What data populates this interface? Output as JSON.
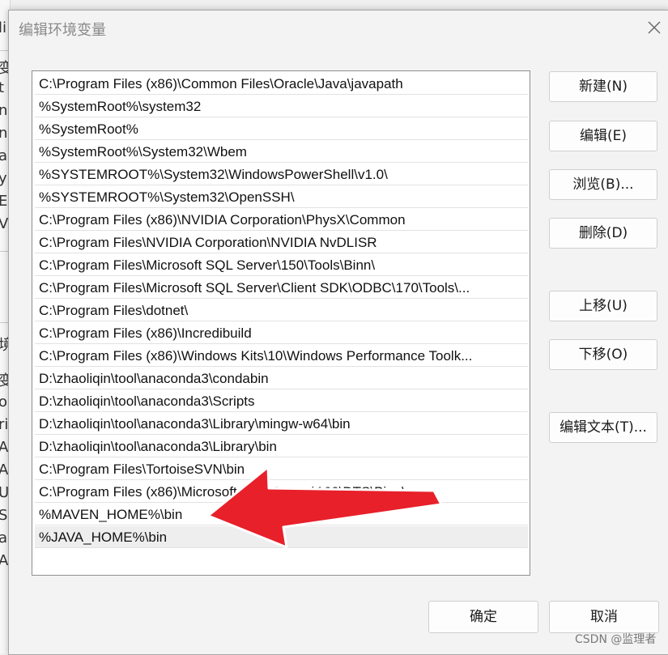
{
  "dialog": {
    "title": "编辑环境变量"
  },
  "paths": [
    "C:\\Program Files (x86)\\Common Files\\Oracle\\Java\\javapath",
    "%SystemRoot%\\system32",
    "%SystemRoot%",
    "%SystemRoot%\\System32\\Wbem",
    "%SYSTEMROOT%\\System32\\WindowsPowerShell\\v1.0\\",
    "%SYSTEMROOT%\\System32\\OpenSSH\\",
    "C:\\Program Files (x86)\\NVIDIA Corporation\\PhysX\\Common",
    "C:\\Program Files\\NVIDIA Corporation\\NVIDIA NvDLISR",
    "C:\\Program Files\\Microsoft SQL Server\\150\\Tools\\Binn\\",
    "C:\\Program Files\\Microsoft SQL Server\\Client SDK\\ODBC\\170\\Tools\\...",
    "C:\\Program Files\\dotnet\\",
    "C:\\Program Files (x86)\\Incredibuild",
    "C:\\Program Files (x86)\\Windows Kits\\10\\Windows Performance Toolk...",
    "D:\\zhaoliqin\\tool\\anaconda3\\condabin",
    "D:\\zhaoliqin\\tool\\anaconda3\\Scripts",
    "D:\\zhaoliqin\\tool\\anaconda3\\Library\\mingw-w64\\bin",
    "D:\\zhaoliqin\\tool\\anaconda3\\Library\\bin",
    "C:\\Program Files\\TortoiseSVN\\bin",
    "C:\\Program Files (x86)\\Microsoft SQL Server\\160\\DTS\\Binn\\",
    "%MAVEN_HOME%\\bin",
    "%JAVA_HOME%\\bin"
  ],
  "selected_index": 20,
  "buttons": {
    "new": "新建(N)",
    "edit": "编辑(E)",
    "browse": "浏览(B)...",
    "delete": "删除(D)",
    "move_up": "上移(U)",
    "move_down": "下移(O)",
    "edit_text": "编辑文本(T)...",
    "ok": "确定",
    "cancel": "取消"
  },
  "background_fragments": [
    "li",
    "变",
    "t",
    "n",
    "n",
    "a",
    "y",
    "E",
    "V",
    "境",
    "变",
    "o",
    "ri",
    "A",
    "A",
    "U",
    "S",
    "a",
    "A"
  ],
  "watermark": "CSDN @监理者",
  "colors": {
    "annotation_arrow": "#e8202a"
  },
  "icons": {
    "close": "close-icon",
    "annotation": "red-arrow-icon"
  }
}
